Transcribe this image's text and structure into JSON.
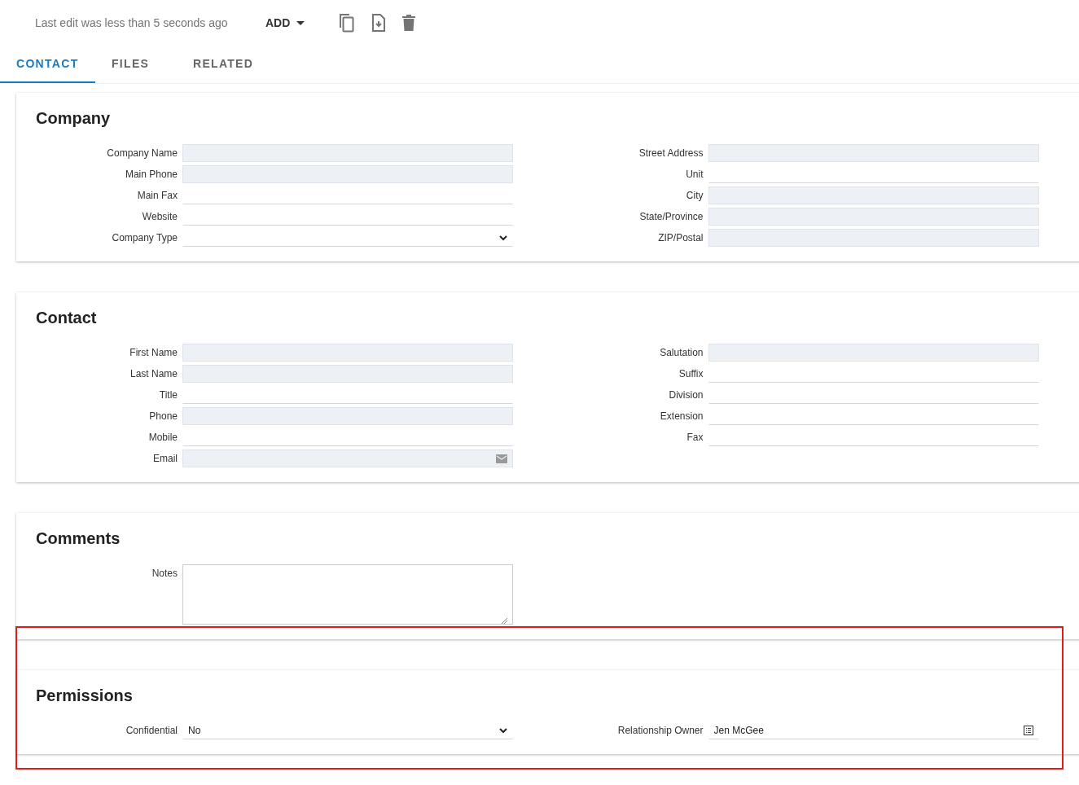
{
  "header": {
    "status": "Last edit was less than 5 seconds ago",
    "add_menu": "ADD"
  },
  "tabs": [
    {
      "label": "CONTACT",
      "selected": true
    },
    {
      "label": "FILES",
      "selected": false
    },
    {
      "label": "RELATED",
      "selected": false
    }
  ],
  "sections": [
    {
      "title": "Company",
      "columns": [
        [
          {
            "label": "Company Name",
            "kind": "text",
            "shaded": true
          },
          {
            "label": "Main Phone",
            "kind": "text",
            "shaded": true
          },
          {
            "label": "Main Fax",
            "kind": "text",
            "shaded": false
          },
          {
            "label": "Website",
            "kind": "text",
            "shaded": false
          },
          {
            "label": "Company Type",
            "kind": "select",
            "shaded": false
          }
        ],
        [
          {
            "label": "Street Address",
            "kind": "text",
            "shaded": true
          },
          {
            "label": "Unit",
            "kind": "text",
            "shaded": false
          },
          {
            "label": "City",
            "kind": "text",
            "shaded": true
          },
          {
            "label": "State/Province",
            "kind": "text",
            "shaded": true
          },
          {
            "label": "ZIP/Postal",
            "kind": "text",
            "shaded": true
          }
        ]
      ]
    },
    {
      "title": "Contact",
      "columns": [
        [
          {
            "label": "First Name",
            "kind": "text",
            "shaded": true
          },
          {
            "label": "Last Name",
            "kind": "text",
            "shaded": true
          },
          {
            "label": "Title",
            "kind": "text",
            "shaded": false
          },
          {
            "label": "Phone",
            "kind": "text",
            "shaded": true
          },
          {
            "label": "Mobile",
            "kind": "text",
            "shaded": false
          },
          {
            "label": "Email",
            "kind": "email",
            "shaded": true
          }
        ],
        [
          {
            "label": "Salutation",
            "kind": "text",
            "shaded": true
          },
          {
            "label": "Suffix",
            "kind": "text",
            "shaded": false
          },
          {
            "label": "Division",
            "kind": "text",
            "shaded": false
          },
          {
            "label": "Extension",
            "kind": "text",
            "shaded": false
          },
          {
            "label": "Fax",
            "kind": "text",
            "shaded": false
          }
        ]
      ]
    },
    {
      "title": "Comments",
      "columns": [
        [
          {
            "label": "Notes",
            "kind": "textarea",
            "shaded": false
          }
        ]
      ]
    },
    {
      "title": "Permissions",
      "highlighted": true,
      "columns": [
        [
          {
            "label": "Confidential",
            "kind": "select",
            "shaded": false,
            "value": "No"
          }
        ],
        [
          {
            "label": "Relationship Owner",
            "kind": "lookup",
            "shaded": false,
            "value": "Jen McGee"
          }
        ]
      ]
    }
  ]
}
